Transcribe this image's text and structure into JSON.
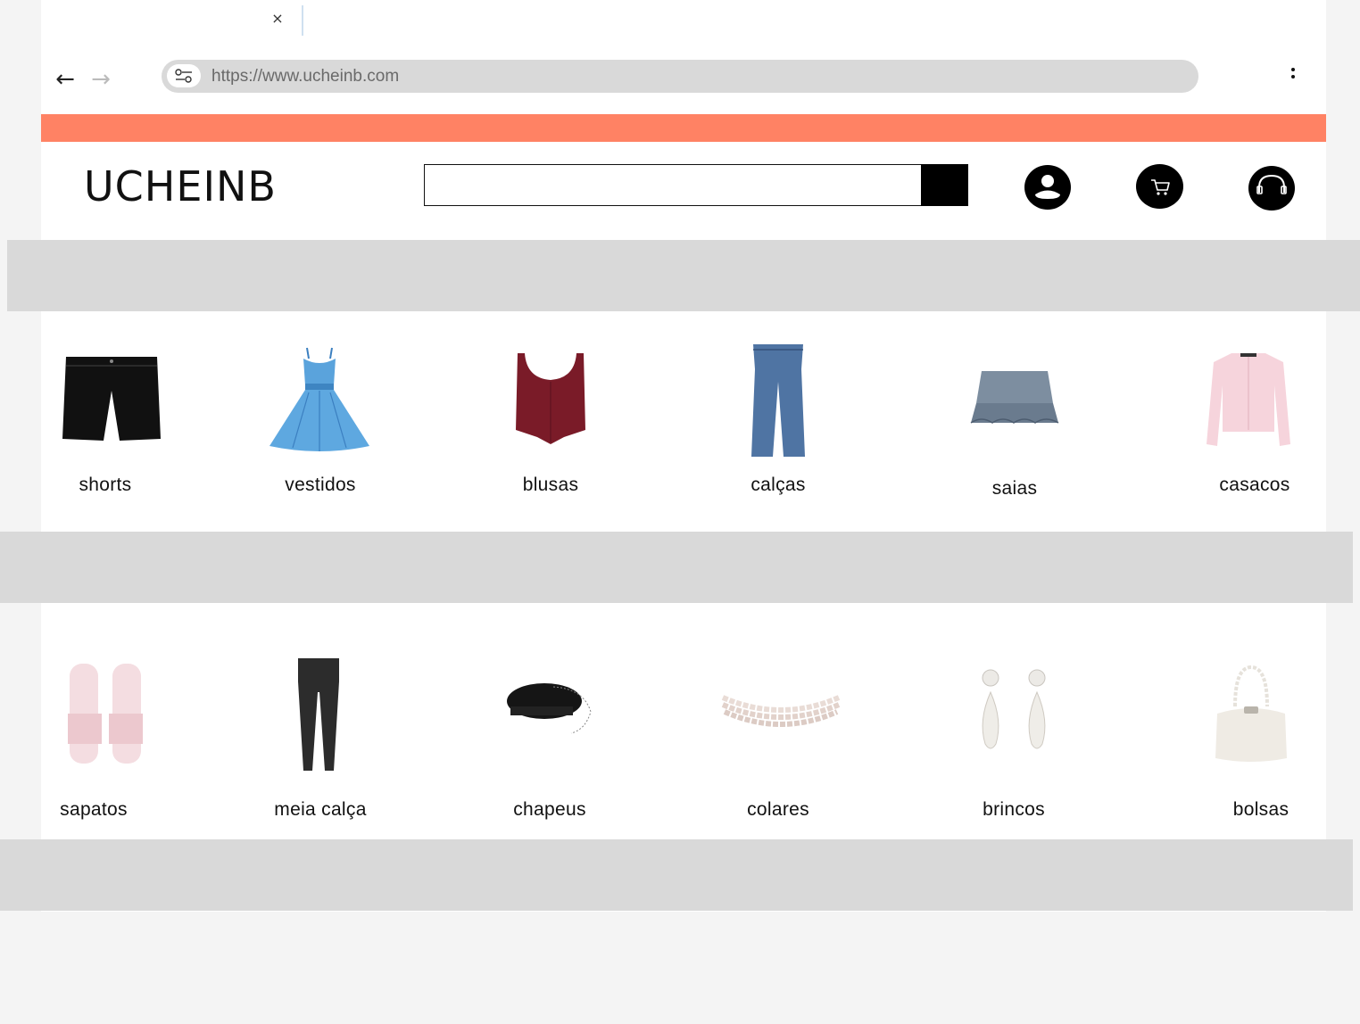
{
  "browser": {
    "url": "https://www.ucheinb.com",
    "tab_close_glyph": "×"
  },
  "header": {
    "logo": "UCHEINB",
    "search": {
      "placeholder": "",
      "value": ""
    },
    "icons": [
      "user-icon",
      "cart-icon",
      "headset-icon"
    ]
  },
  "colors": {
    "promo_bar": "#ff8264",
    "band": "#d9d9d9",
    "icon_bg": "#000000"
  },
  "categories_row_1": [
    {
      "label": "shorts"
    },
    {
      "label": "vestidos"
    },
    {
      "label": "blusas"
    },
    {
      "label": "calças"
    },
    {
      "label": "saias"
    },
    {
      "label": "casacos"
    }
  ],
  "categories_row_2": [
    {
      "label": "sapatos"
    },
    {
      "label": "meia calça"
    },
    {
      "label": "chapeus"
    },
    {
      "label": "colares"
    },
    {
      "label": "brincos"
    },
    {
      "label": "bolsas"
    }
  ]
}
